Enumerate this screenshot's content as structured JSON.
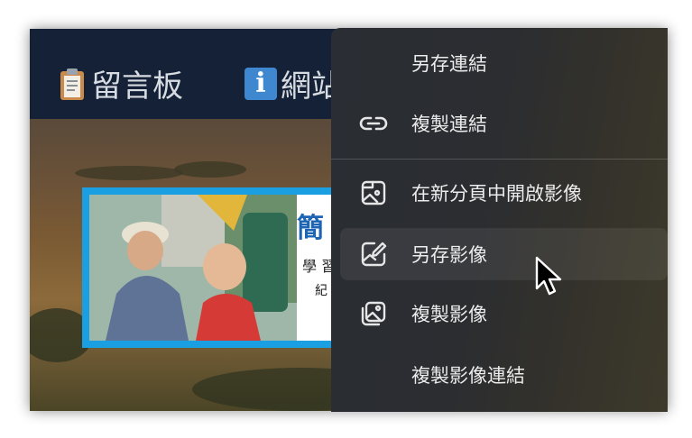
{
  "nav": {
    "board_label": "留言板",
    "info_icon_letter": "i",
    "info_label_partial": "網站"
  },
  "photo_card": {
    "title_char": "簡",
    "line1": "學 習",
    "line2": "紀"
  },
  "context_menu": {
    "items": [
      {
        "label": "另存連結",
        "icon": ""
      },
      {
        "label": "複製連結",
        "icon": "link-icon"
      },
      {
        "label": "在新分頁中開啟影像",
        "icon": "open-image-new-tab-icon"
      },
      {
        "label": "另存影像",
        "icon": "save-image-icon",
        "highlighted": true
      },
      {
        "label": "複製影像",
        "icon": "copy-image-icon"
      },
      {
        "label": "複製影像連結",
        "icon": ""
      }
    ]
  },
  "colors": {
    "topbar": "#152137",
    "menu_bg": "#2b2d31",
    "photo_border": "#1aa0e2",
    "title_blue": "#1e64b4"
  }
}
